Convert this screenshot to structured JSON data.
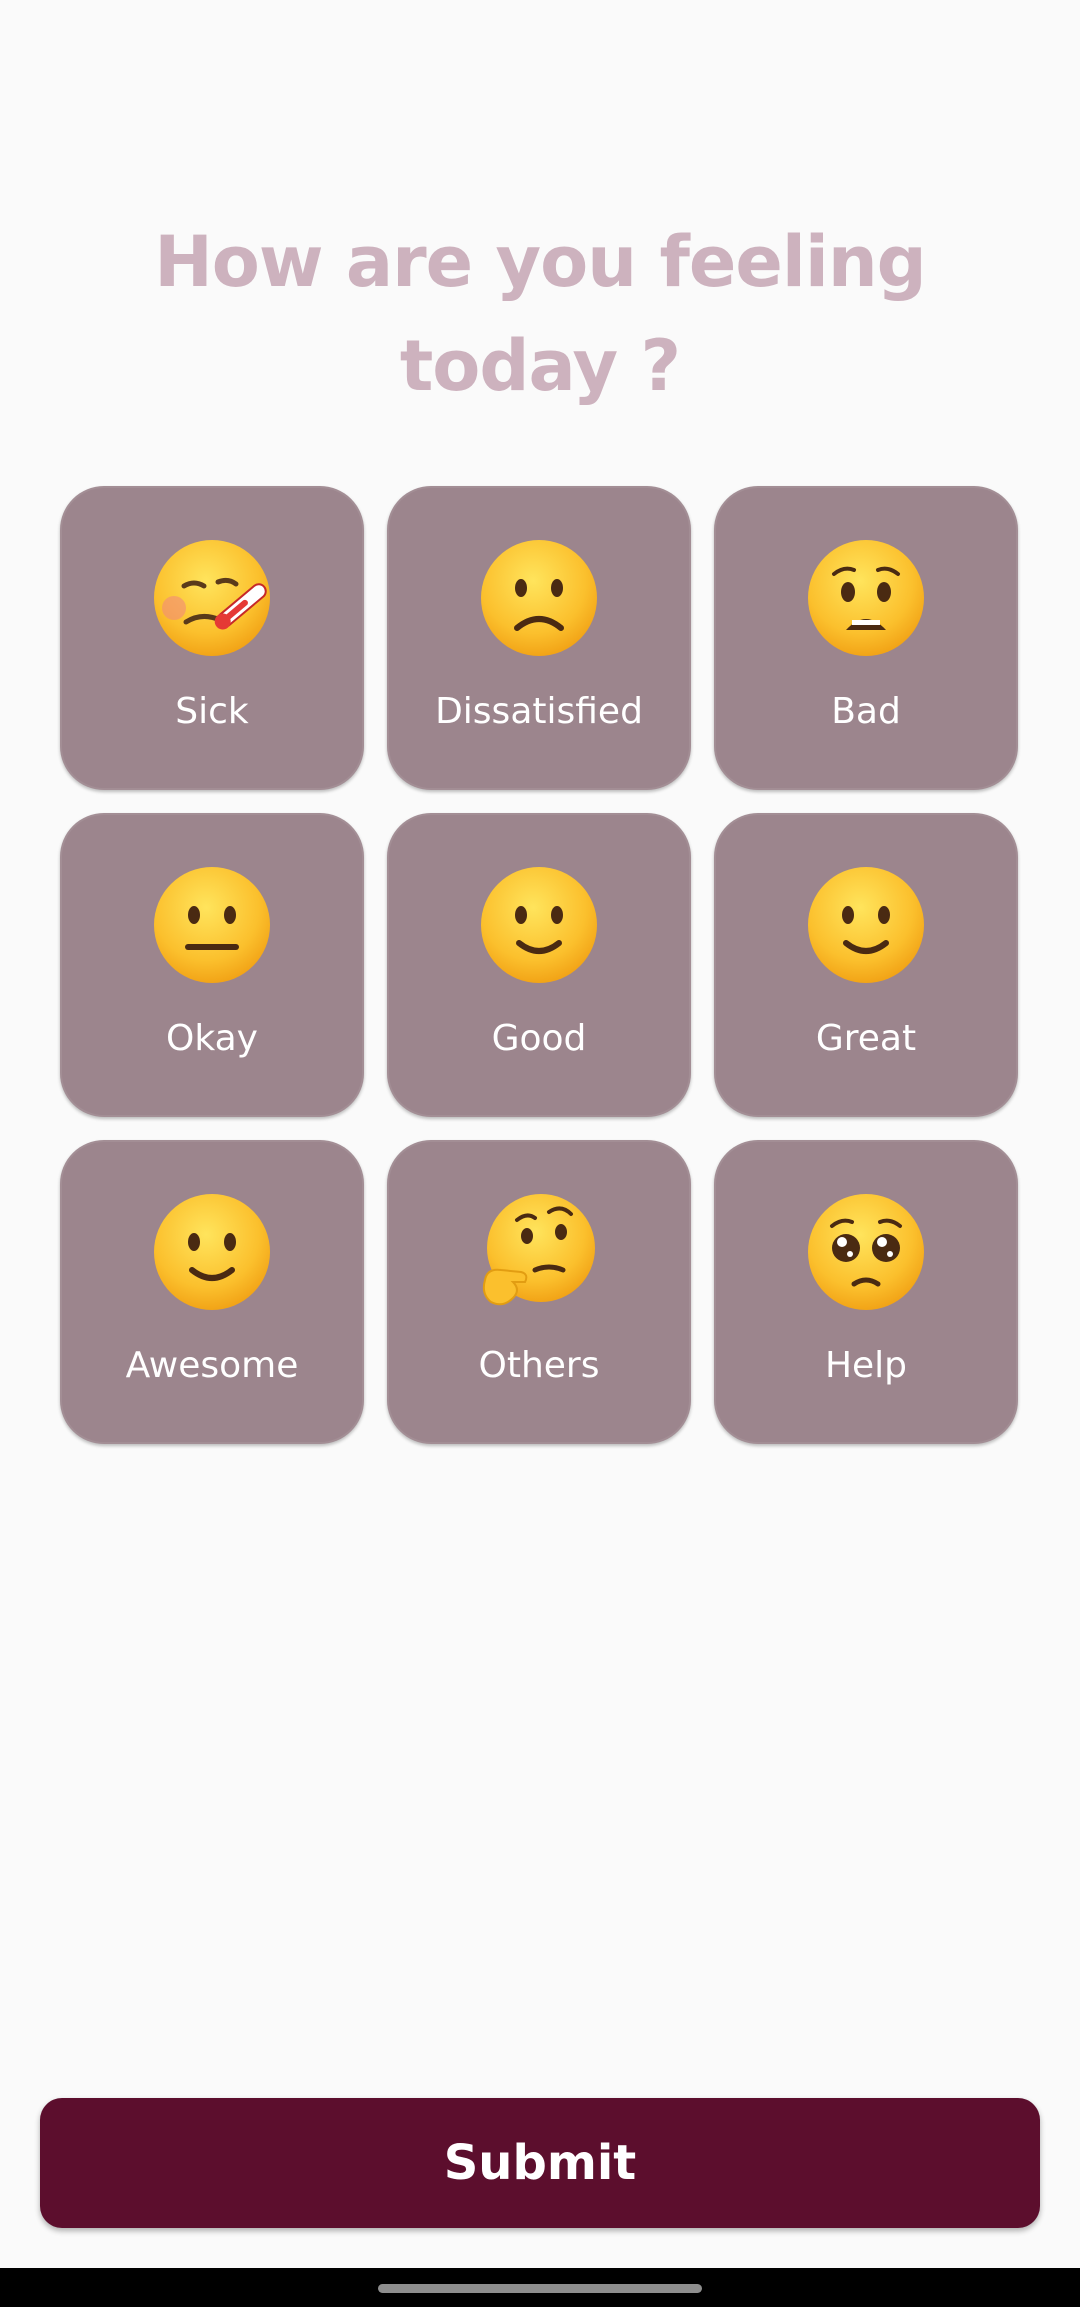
{
  "title": {
    "line1": "How are you feeling",
    "line2": "today ?"
  },
  "moods": [
    {
      "label": "Sick",
      "icon": "face-with-thermometer-icon"
    },
    {
      "label": "Dissatisfied",
      "icon": "frowning-face-icon"
    },
    {
      "label": "Bad",
      "icon": "anxious-face-icon"
    },
    {
      "label": "Okay",
      "icon": "neutral-face-icon"
    },
    {
      "label": "Good",
      "icon": "slightly-smiling-face-icon"
    },
    {
      "label": "Great",
      "icon": "slightly-smiling-face-icon"
    },
    {
      "label": "Awesome",
      "icon": "slightly-smiling-face-icon"
    },
    {
      "label": "Others",
      "icon": "thinking-face-icon"
    },
    {
      "label": "Help",
      "icon": "pleading-face-icon"
    }
  ],
  "submit": {
    "label": "Submit"
  },
  "colors": {
    "background": "#fafafa",
    "title": "#cdb2be",
    "tile": "#9c858d",
    "tile_text": "#ffffff",
    "button": "#5c0e2d",
    "button_text": "#ffffff"
  }
}
